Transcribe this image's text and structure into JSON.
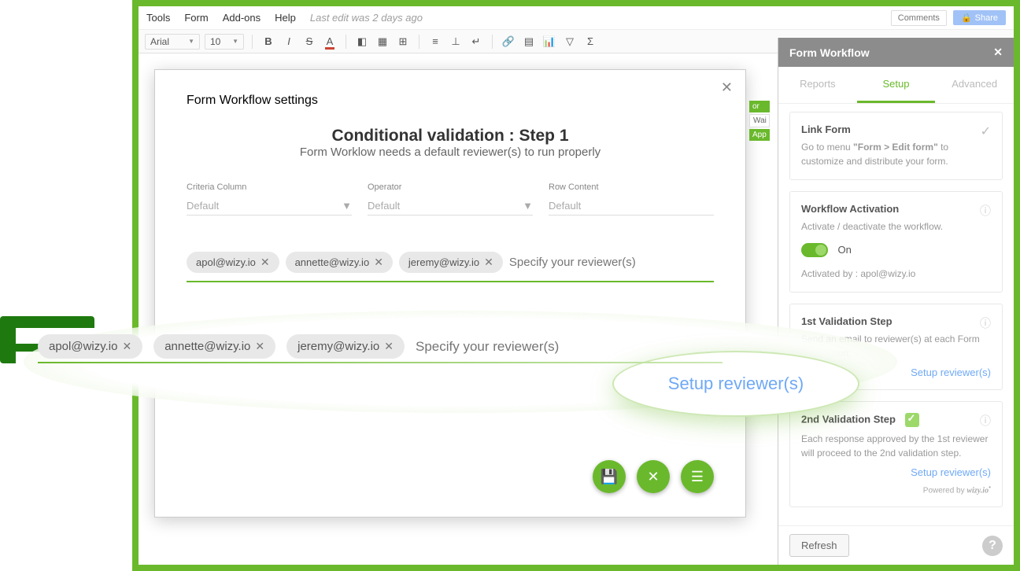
{
  "menubar": {
    "tools": "Tools",
    "form": "Form",
    "addons": "Add-ons",
    "help": "Help",
    "last_edit": "Last edit was 2 days ago",
    "comments": "Comments",
    "share": "Share"
  },
  "toolbar": {
    "font": "Arial",
    "size": "10"
  },
  "modal": {
    "title": "Form Workflow settings",
    "heading": "Conditional validation : Step 1",
    "subheading": "Form Worklow needs a default reviewer(s) to run properly",
    "criteria_label": "Criteria Column",
    "operator_label": "Operator",
    "row_label": "Row Content",
    "default": "Default",
    "reviewers": [
      "apol@wizy.io",
      "annette@wizy.io",
      "jeremy@wizy.io"
    ],
    "placeholder": "Specify your reviewer(s)"
  },
  "sidebar": {
    "title": "Form Workflow",
    "tabs": {
      "reports": "Reports",
      "setup": "Setup",
      "advanced": "Advanced"
    },
    "linkform": {
      "title": "Link Form",
      "text_pre": "Go to menu ",
      "text_bold": "\"Form > Edit form\"",
      "text_post": " to customize and distribute your form."
    },
    "activation": {
      "title": "Workflow Activation",
      "text": "Activate / deactivate the workflow.",
      "on": "On",
      "by": "Activated by : apol@wizy.io"
    },
    "step1": {
      "title": "1st Validation Step",
      "text": "Send an email to reviewer(s) at each Form submission.",
      "link": "Setup reviewer(s)"
    },
    "step2": {
      "title": "2nd Validation Step",
      "text": "Each response approved by the 1st reviewer will proceed to the 2nd validation step.",
      "link": "Setup reviewer(s)"
    },
    "powered": "Powered by ",
    "brand": "wizy.io",
    "refresh": "Refresh"
  },
  "callout": {
    "label": "Setup reviewer(s)"
  },
  "cells": {
    "or": "or",
    "wai": "Wai",
    "app": "App"
  }
}
